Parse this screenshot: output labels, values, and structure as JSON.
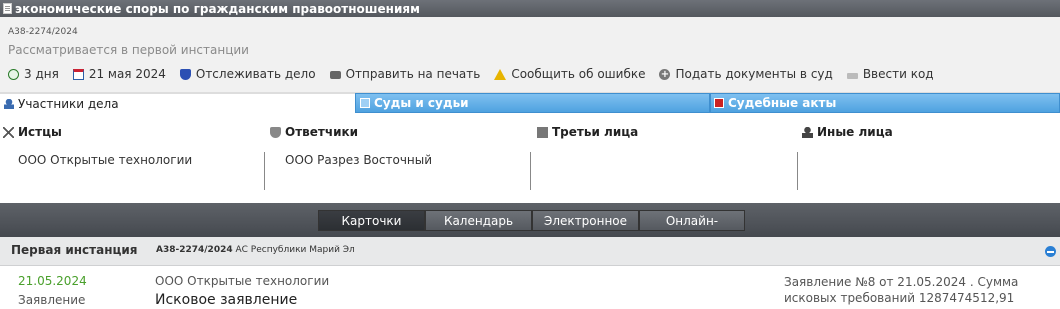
{
  "header": {
    "title": "экономические споры по гражданским правоотношениям",
    "case_number": "А38-2274/2024",
    "status": "Рассматривается в первой инстанции"
  },
  "actions": [
    {
      "label": "3 дня",
      "icon": "clock-icon"
    },
    {
      "label": "21 мая 2024",
      "icon": "calendar-icon"
    },
    {
      "label": "Отслеживать дело",
      "icon": "shield-icon"
    },
    {
      "label": "Отправить на печать",
      "icon": "printer-icon"
    },
    {
      "label": "Сообщить об ошибке",
      "icon": "warning-icon"
    },
    {
      "label": "Подать документы в суд",
      "icon": "plus-icon"
    },
    {
      "label": "Ввести код",
      "icon": "key-icon"
    }
  ],
  "tabs": {
    "participants": "Участники дела",
    "courts": "Суды и судьи",
    "acts": "Судебные акты"
  },
  "participants": {
    "plaintiffs": {
      "title": "Истцы",
      "items": [
        "ООО Открытые технологии"
      ]
    },
    "defendants": {
      "title": "Ответчики",
      "items": [
        "ООО Разрез Восточный"
      ]
    },
    "third_parties": {
      "title": "Третьи лица",
      "items": []
    },
    "others": {
      "title": "Иные лица",
      "items": []
    }
  },
  "bottom_nav": [
    {
      "label": "Карточки",
      "active": true
    },
    {
      "label": "Календарь",
      "active": false
    },
    {
      "label": "Электронное дело",
      "active": false
    },
    {
      "label": "Онлайн-заседания",
      "active": false
    }
  ],
  "instance": {
    "title": "Первая инстанция",
    "case_number": "А38-2274/2024",
    "court": "АС Республики Марий Эл"
  },
  "document": {
    "date": "21.05.2024",
    "type": "Заявление",
    "party": "ООО Открытые технологии",
    "title": "Исковое заявление",
    "info": "Заявление №8 от 21.05.2024 . Сумма исковых требований 1287474512,91"
  },
  "colors": {
    "accent_blue": "#4fa2e0",
    "date_green": "#4aa02c",
    "dark_bar": "#54585e"
  }
}
